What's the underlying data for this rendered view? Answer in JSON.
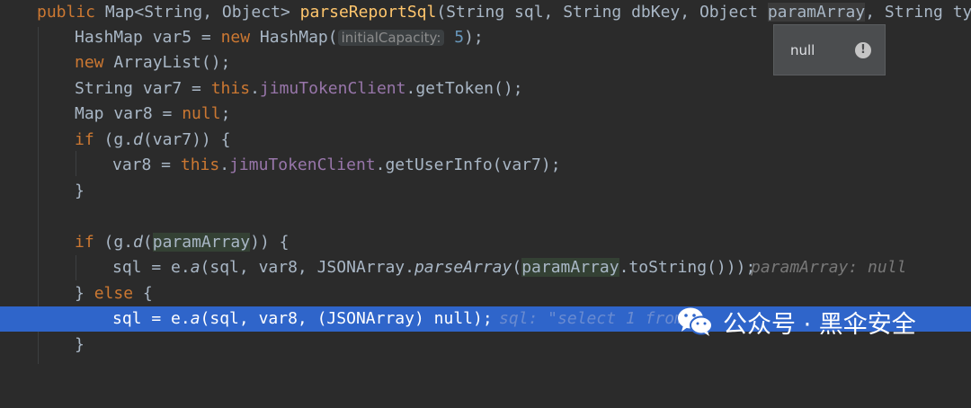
{
  "code": {
    "sig": {
      "kw": "public",
      "type": "Map<String, Object>",
      "name": "parseReportSql",
      "p1": "(String sql, String dbKey, Object ",
      "p2": "paramArray",
      "p3": ", String type)"
    },
    "l2": {
      "a": "HashMap var5 = ",
      "kw": "new",
      "b": " HashMap(",
      "hint": "initialCapacity:",
      "num": "5",
      "c": ");"
    },
    "l3": {
      "kw": "new",
      "b": " ArrayList();"
    },
    "l4": {
      "a": "String var7 = ",
      "kw": "this",
      "b": ".",
      "fld": "jimuTokenClient",
      "c": ".getToken();"
    },
    "l5": {
      "a": "Map var8 = ",
      "kw": "null",
      "b": ";"
    },
    "l6": {
      "kw": "if",
      "a": " (g.",
      "it": "d",
      "b": "(var7)) {"
    },
    "l7": {
      "a": "var8 = ",
      "kw": "this",
      "b": ".",
      "fld": "jimuTokenClient",
      "c": ".getUserInfo(var7);"
    },
    "l8": {
      "a": "}"
    },
    "l10": {
      "kw": "if",
      "a": " (g.",
      "it": "d",
      "b": "(",
      "p": "paramArray",
      "c": ")) {"
    },
    "l11": {
      "a": "sql = e.",
      "it1": "a",
      "b": "(sql, var8, JSONArray.",
      "it2": "parseArray",
      "c": "(",
      "p": "paramArray",
      "d": ".toString()));",
      "inline": "paramArray: null"
    },
    "l12": {
      "a": "} ",
      "kw": "else",
      "b": " {"
    },
    "l13": {
      "a": "sql = e.",
      "it": "a",
      "b": "(sql, var8, (JSONArray) ",
      "kw": "null",
      "c": ");",
      "inline": "sql: \"select 1 from"
    },
    "l14": {
      "a": "}"
    }
  },
  "tooltip": {
    "value": "null",
    "icon": "warning-icon",
    "icon_glyph": "!"
  },
  "watermark": {
    "text": "公众号 · 黑伞安全",
    "icon": "wechat-icon"
  },
  "colors": {
    "background": "#2b2b2b",
    "keyword": "#cc7832",
    "method": "#ffc66d",
    "field": "#9876aa",
    "number": "#6897bb",
    "highlight_line": "#2f65ca"
  }
}
